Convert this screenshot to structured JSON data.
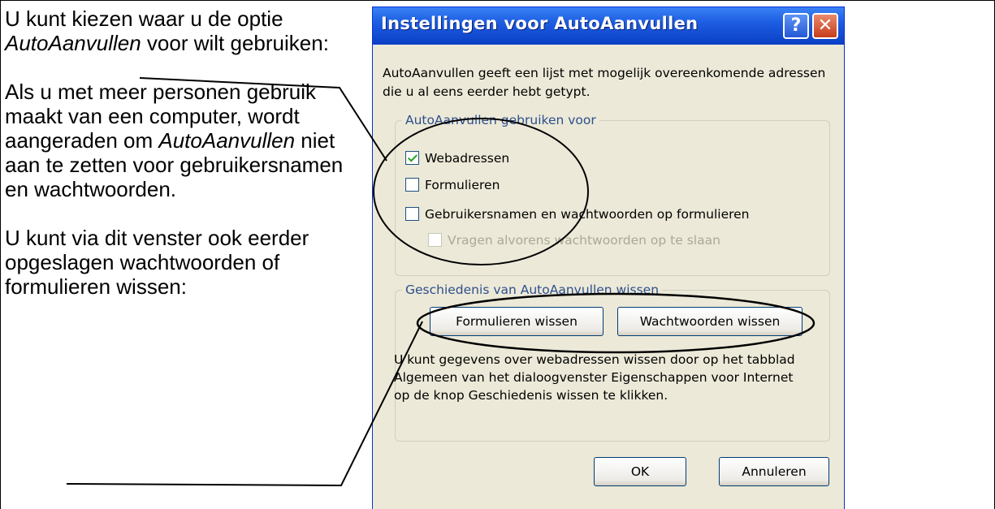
{
  "explanation": {
    "para1_prefix": "U kunt kiezen waar u de optie",
    "para1_italic": "AutoAanvullen",
    "para1_suffix": "voor wilt gebruiken:",
    "para2_prefix": "Als u met meer personen gebruik maakt van een computer, wordt aangeraden om",
    "para2_italic": "AutoAanvullen",
    "para2_suffix": "niet aan te zetten voor gebruikersnamen en wachtwoorden.",
    "para3": "U kunt via dit venster ook eerder opgeslagen wachtwoorden of formulieren wissen:"
  },
  "dialog": {
    "title": "Instellingen voor AutoAanvullen",
    "help_glyph": "?",
    "close_glyph": "✕",
    "intro": "AutoAanvullen geeft een lijst met mogelijk overeenkomende adressen die u al eens eerder hebt getypt.",
    "group_use": {
      "legend": "AutoAanvullen gebruiken voor",
      "options": [
        {
          "label": "Webadressen",
          "checked": true
        },
        {
          "label": "Formulieren",
          "checked": false
        },
        {
          "label": "Gebruikersnamen en wachtwoorden op formulieren",
          "checked": false
        },
        {
          "label": "Vragen alvorens wachtwoorden op te slaan",
          "checked": false,
          "disabled": true
        }
      ]
    },
    "group_clear": {
      "legend": "Geschiedenis van AutoAanvullen wissen",
      "clear_forms_button": "Formulieren wissen",
      "clear_passwords_button": "Wachtwoorden wissen",
      "note": "U kunt gegevens over webadressen wissen door op het tabblad Algemeen van het dialoogvenster Eigenschappen voor Internet op de knop Geschiedenis wissen te klikken."
    },
    "ok_button": "OK",
    "cancel_button": "Annuleren"
  }
}
